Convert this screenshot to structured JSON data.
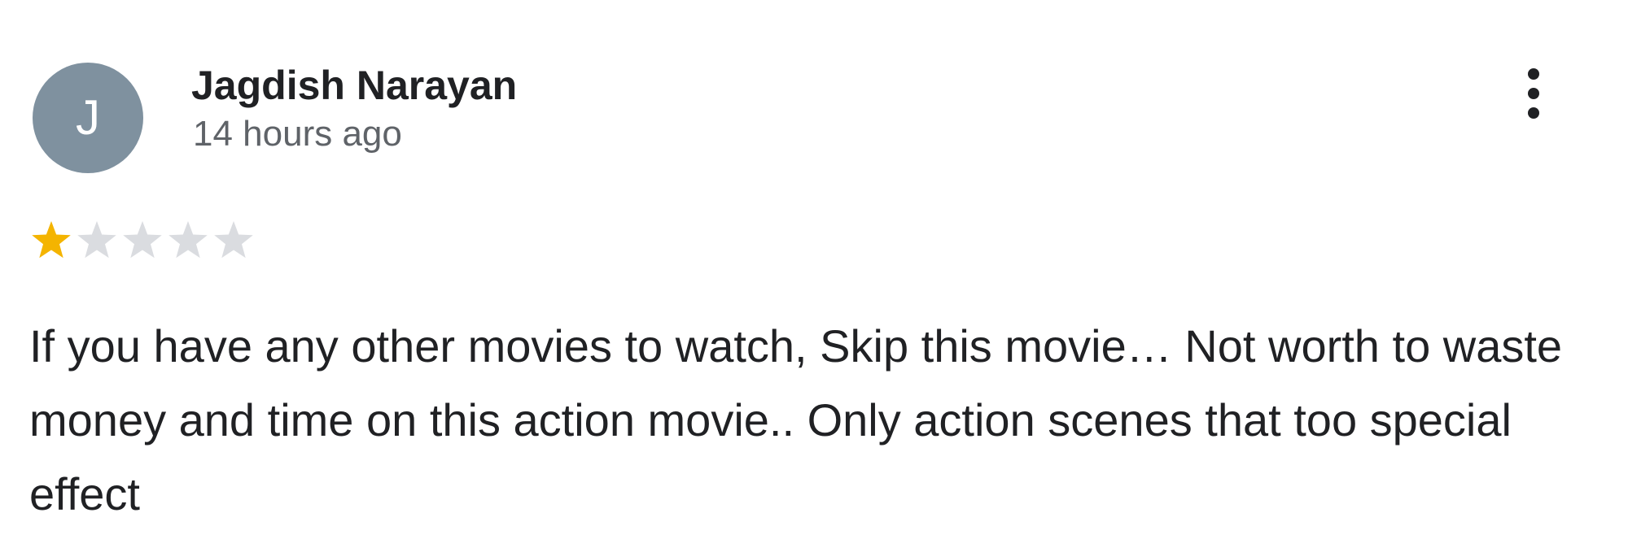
{
  "review": {
    "author": {
      "name": "Jagdish Narayan",
      "avatar_initial": "J",
      "avatar_color": "#7f919f"
    },
    "time": "14 hours ago",
    "rating": {
      "value": 1,
      "max": 5,
      "filled_color": "#f4b400",
      "empty_color": "#dadce0"
    },
    "text": "If you have any other movies to watch, Skip this movie… Not worth to waste money and time on this action movie.. Only action scenes that too special effect",
    "menu_icon": "more-vert-icon"
  }
}
